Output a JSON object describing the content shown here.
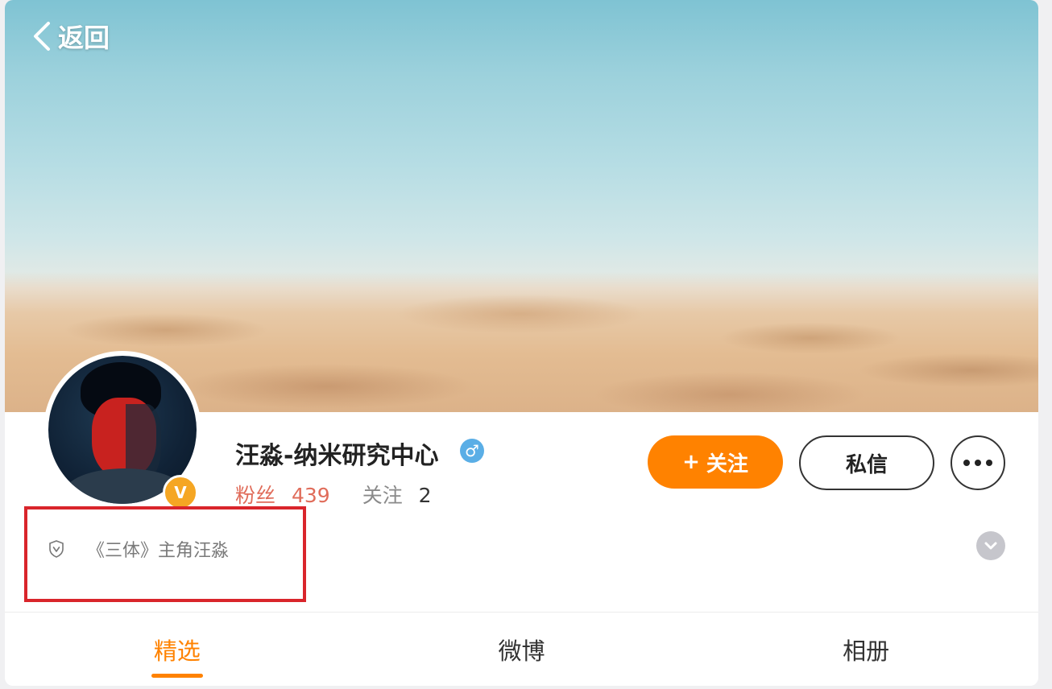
{
  "header": {
    "back_label": "返回"
  },
  "profile": {
    "name": "汪淼-纳米研究中心",
    "verified_badge": "V",
    "gender_icon": "♂",
    "fans_label": "粉丝",
    "fans_count": "439",
    "following_label": "关注",
    "following_count": "2",
    "bio": "《三体》主角汪淼"
  },
  "actions": {
    "follow_label": "关注",
    "follow_icon": "+",
    "message_label": "私信"
  },
  "tabs": [
    {
      "label": "精选"
    },
    {
      "label": "微博"
    },
    {
      "label": "相册"
    }
  ],
  "colors": {
    "accent": "#ff8200",
    "fans": "#e06c5a",
    "verified": "#f5a623",
    "gender": "#5aaee6",
    "highlight_box": "#d9252b"
  }
}
